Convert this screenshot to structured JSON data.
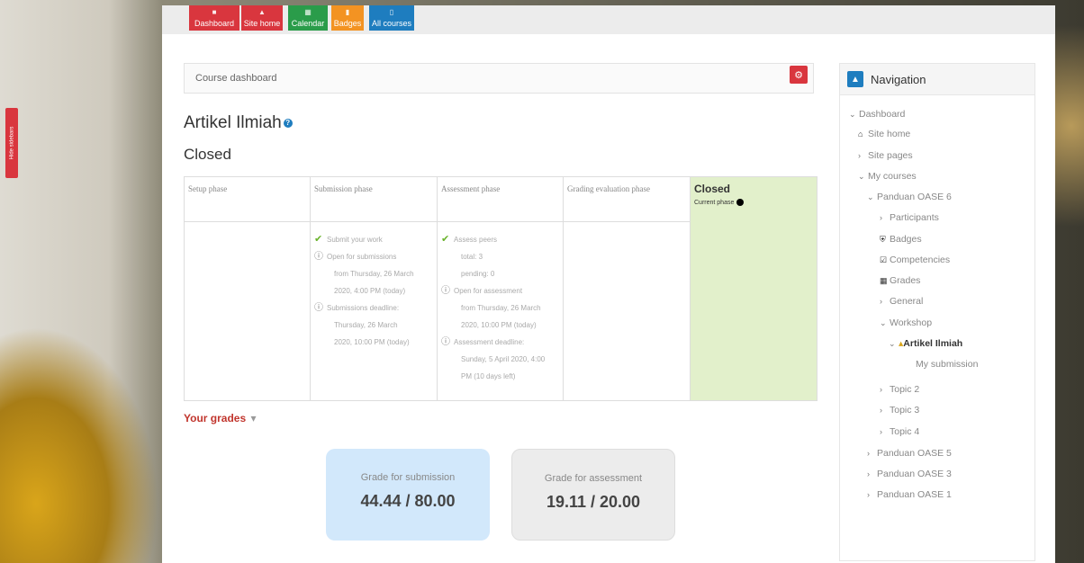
{
  "sidebar_toggle": {
    "label": "Hide sidebars"
  },
  "topnav": [
    {
      "label": "Dashboard",
      "icon": "tachometer-icon",
      "color": "#d9363e"
    },
    {
      "label": "Site home",
      "icon": "home-icon",
      "color": "#d9363e"
    },
    {
      "label": "Calendar",
      "icon": "calendar-icon",
      "color": "#2a9c4a"
    },
    {
      "label": "Badges",
      "icon": "bookmark-icon",
      "color": "#f39322"
    },
    {
      "label": "All courses",
      "icon": "file-icon",
      "color": "#1e7dbf"
    }
  ],
  "breadcrumb": {
    "text": "Course dashboard"
  },
  "page": {
    "title": "Artikel Ilmiah",
    "phase": "Closed"
  },
  "phases": [
    {
      "name": "Setup phase",
      "tasks": []
    },
    {
      "name": "Submission phase",
      "tasks": [
        {
          "icon": "check",
          "lines": [
            "Submit your work"
          ]
        },
        {
          "icon": "info",
          "lines": [
            "Open for submissions",
            "from Thursday, 26 March",
            "2020, 4:00 PM (today)"
          ]
        },
        {
          "icon": "info",
          "lines": [
            "Submissions deadline:",
            "Thursday, 26 March",
            "2020, 10:00 PM (today)"
          ]
        }
      ]
    },
    {
      "name": "Assessment phase",
      "tasks": [
        {
          "icon": "check",
          "lines": [
            "Assess peers",
            "total: 3",
            "pending: 0"
          ]
        },
        {
          "icon": "info",
          "lines": [
            "Open for assessment",
            "from Thursday, 26 March",
            "2020, 10:00 PM (today)"
          ]
        },
        {
          "icon": "info",
          "lines": [
            "Assessment deadline:",
            "Sunday, 5 April 2020, 4:00",
            "PM (10 days left)"
          ]
        }
      ]
    },
    {
      "name": "Grading evaluation phase",
      "tasks": []
    },
    {
      "name": "Closed",
      "current_label": "Current phase",
      "tasks": []
    }
  ],
  "grades": {
    "heading": "Your grades",
    "submission": {
      "label": "Grade for submission",
      "value": "44.44 / 80.00",
      "color": "#d2e8fb"
    },
    "assessment": {
      "label": "Grade for assessment",
      "value": "19.11 / 20.00",
      "color": "#ececec"
    }
  },
  "navigation": {
    "title": "Navigation",
    "items": {
      "dashboard": "Dashboard",
      "site_home": "Site home",
      "site_pages": "Site pages",
      "my_courses": "My courses",
      "course1": "Panduan OASE 6",
      "participants": "Participants",
      "badges": "Badges",
      "competencies": "Competencies",
      "grades": "Grades",
      "general": "General",
      "workshop": "Workshop",
      "artikel": "Artikel Ilmiah",
      "my_submission": "My submission",
      "topic2": "Topic 2",
      "topic3": "Topic 3",
      "topic4": "Topic 4",
      "course5": "Panduan OASE 5",
      "course3": "Panduan OASE 3",
      "course1b": "Panduan OASE 1"
    }
  }
}
